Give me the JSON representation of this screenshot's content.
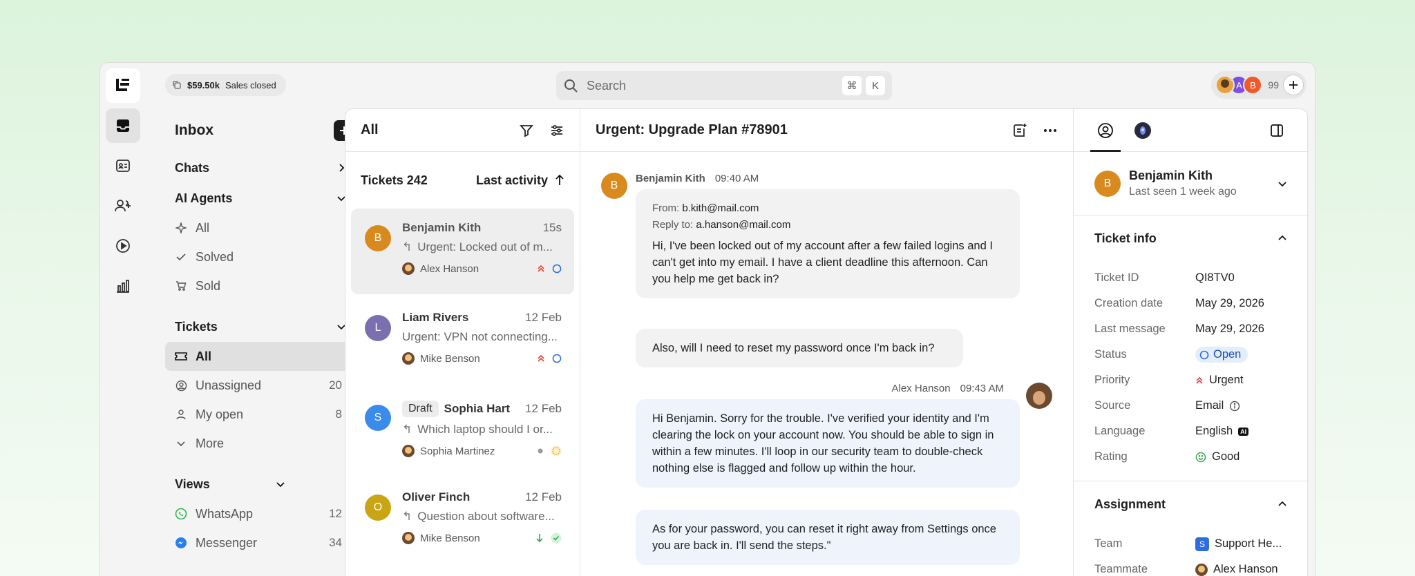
{
  "topbar": {
    "sales_amount": "$59.50k",
    "sales_label": "Sales closed",
    "search_placeholder": "Search",
    "search_kbd_cmd": "⌘",
    "search_kbd_key": "K",
    "avatar_count": "99",
    "avatars": [
      {
        "letter": "",
        "color": "#e8a23a"
      },
      {
        "letter": "A",
        "color": "#7b4fe0"
      },
      {
        "letter": "B",
        "color": "#ef5a2b"
      }
    ]
  },
  "sidebar": {
    "title": "Inbox",
    "chats_label": "Chats",
    "ai_agents_label": "AI Agents",
    "ai_items": [
      {
        "label": "All",
        "icon": "sparkle-icon"
      },
      {
        "label": "Solved",
        "icon": "check-icon"
      },
      {
        "label": "Sold",
        "icon": "cart-icon"
      }
    ],
    "tickets_label": "Tickets",
    "ticket_items": [
      {
        "label": "All",
        "count": "",
        "icon": "ticket-icon"
      },
      {
        "label": "Unassigned",
        "count": "20",
        "icon": "user-circle-icon"
      },
      {
        "label": "My open",
        "count": "8",
        "icon": "user-icon"
      },
      {
        "label": "More",
        "count": "",
        "icon": "chevron-down-icon"
      }
    ],
    "views_label": "Views",
    "view_items": [
      {
        "label": "WhatsApp",
        "count": "12",
        "icon": "whatsapp-icon"
      },
      {
        "label": "Messenger",
        "count": "34",
        "icon": "messenger-icon"
      }
    ]
  },
  "list": {
    "title": "All",
    "count_label": "Tickets 242",
    "sort_label": "Last activity",
    "tickets": [
      {
        "initial": "B",
        "color": "#d98a1f",
        "name": "Benjamin Kith",
        "time": "15s",
        "preview": "Urgent: Locked out of m...",
        "reply": true,
        "assignee": "Alex Hanson",
        "priority": "urgent",
        "status": "open",
        "draft": ""
      },
      {
        "initial": "L",
        "color": "#7b6fb0",
        "name": "Liam Rivers",
        "time": "12 Feb",
        "preview": "Urgent: VPN not connecting...",
        "reply": false,
        "assignee": "Mike Benson",
        "priority": "urgent",
        "status": "open",
        "draft": ""
      },
      {
        "initial": "S",
        "color": "#3b8bea",
        "name": "Sophia Hart",
        "time": "12 Feb",
        "preview": "Which laptop should I or...",
        "reply": true,
        "assignee": "Sophia Martinez",
        "priority": "none",
        "status": "pending",
        "draft": "Draft"
      },
      {
        "initial": "O",
        "color": "#c9a514",
        "name": "Oliver Finch",
        "time": "12 Feb",
        "preview": "Question about software...",
        "reply": true,
        "assignee": "Mike Benson",
        "priority": "low",
        "status": "solved",
        "draft": ""
      }
    ]
  },
  "conversation": {
    "title": "Urgent: Upgrade Plan #78901",
    "msg1": {
      "initial": "B",
      "author": "Benjamin Kith",
      "time": "09:40 AM",
      "from_label": "From:",
      "from": "b.kith@mail.com",
      "replyto_label": "Reply to:",
      "replyto": "a.hanson@mail.com",
      "body": "Hi, I've been locked out of my account after a few failed logins and I can't get into my email. I have a client deadline this afternoon. Can you help me get back in?"
    },
    "msg2": {
      "body": "Also, will I need to reset my password once I'm back in?"
    },
    "msg3": {
      "author": "Alex Hanson",
      "time": "09:43 AM",
      "body": "Hi Benjamin. Sorry for the trouble. I've verified your identity and I'm clearing the lock on your account now. You should be able to sign in within a few minutes. I'll loop in our security team to double-check nothing else is flagged and follow up within the hour."
    },
    "msg4": {
      "body": "As for your password, you can reset it right away from Settings once you are back in. I'll send the steps.\""
    }
  },
  "info": {
    "contact_initial": "B",
    "contact_name": "Benjamin Kith",
    "contact_seen": "Last seen 1 week ago",
    "ticket_info_title": "Ticket info",
    "fields": {
      "ticket_id": {
        "k": "Ticket ID",
        "v": "QI8TV0"
      },
      "creation_date": {
        "k": "Creation date",
        "v": "May 29, 2026"
      },
      "last_message": {
        "k": "Last message",
        "v": "May 29, 2026"
      },
      "status": {
        "k": "Status",
        "v": "Open"
      },
      "priority": {
        "k": "Priority",
        "v": "Urgent"
      },
      "source": {
        "k": "Source",
        "v": "Email"
      },
      "language": {
        "k": "Language",
        "v": "English",
        "badge": "AI"
      },
      "rating": {
        "k": "Rating",
        "v": "Good"
      }
    },
    "assignment_title": "Assignment",
    "team": {
      "k": "Team",
      "v": "Support He...",
      "badge": "S"
    },
    "teammate": {
      "k": "Teammate",
      "v": "Alex Hanson"
    }
  },
  "colors": {
    "accent_blue": "#2d6de0",
    "urgent_red": "#e0413a",
    "solved_green": "#2fa84f",
    "pending_yellow": "#e6b325"
  }
}
